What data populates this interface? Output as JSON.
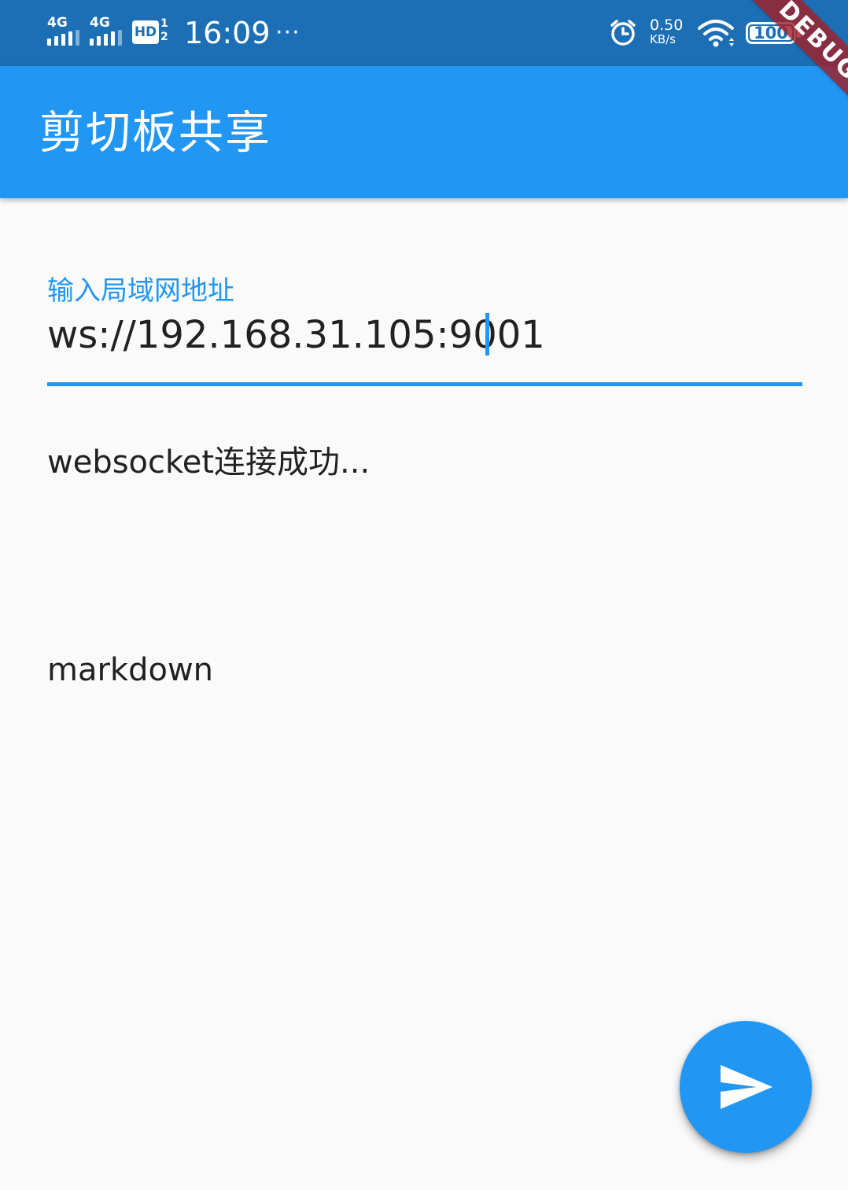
{
  "status_bar": {
    "sim1_network": "4G",
    "sim2_network": "4G",
    "hd_label": "HD",
    "hd_sub": "1 2",
    "time": "16:09",
    "more_indicator": "···",
    "net_speed_value": "0.50",
    "net_speed_unit": "KB/s",
    "battery_level": "100",
    "battery_percent": 100
  },
  "app_bar": {
    "title": "剪切板共享"
  },
  "debug_banner": {
    "label": "DEBUG"
  },
  "address_field": {
    "label": "输入局域网地址",
    "value": "ws://192.168.31.105:9001"
  },
  "connection_status": {
    "text": "websocket连接成功..."
  },
  "clipboard_content": {
    "text": "markdown"
  },
  "fab": {
    "icon": "send-icon"
  },
  "colors": {
    "status_bar": "#1c6fb5",
    "primary": "#2196f3",
    "background": "#fafafa",
    "text": "#212121",
    "debug_banner": "#a01e28"
  }
}
